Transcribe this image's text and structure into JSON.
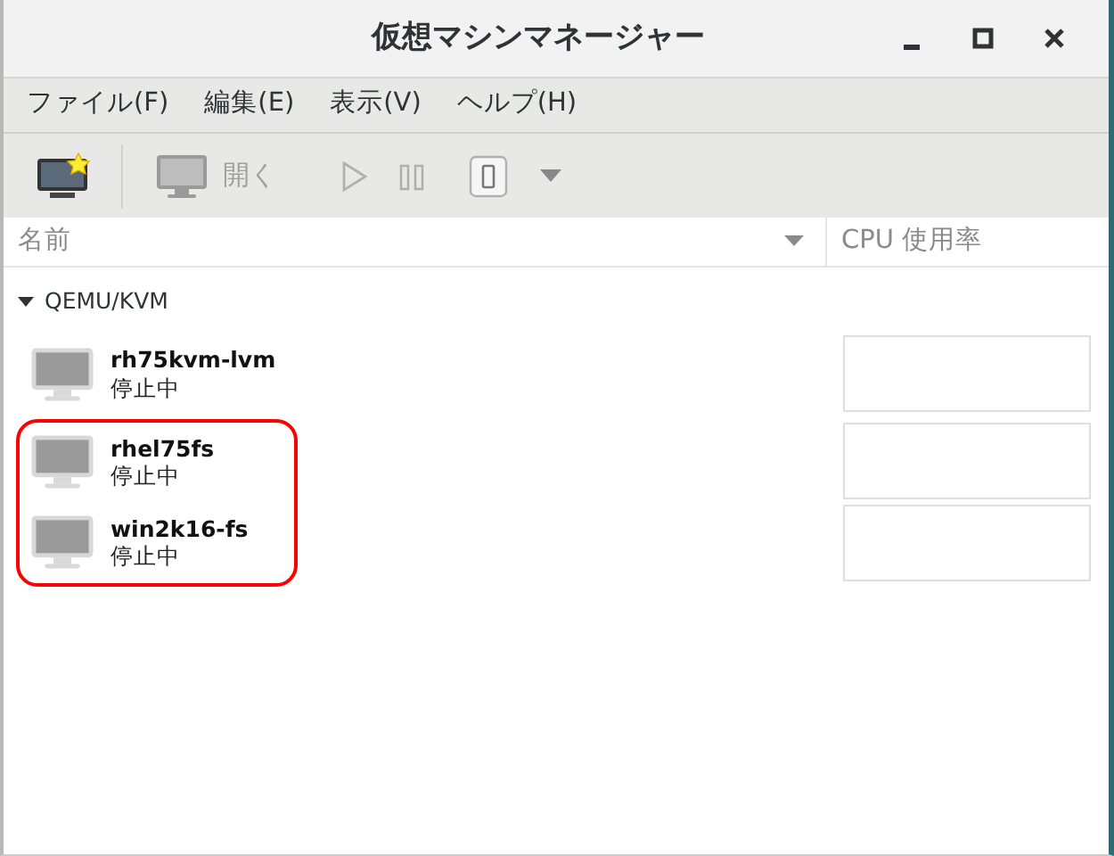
{
  "window": {
    "title": "仮想マシンマネージャー"
  },
  "menu": [
    "ファイル(F)",
    "編集(E)",
    "表示(V)",
    "ヘルプ(H)"
  ],
  "toolbar": [
    {
      "kind": "new",
      "disabled": false
    },
    {
      "kind": "separator"
    },
    {
      "kind": "open",
      "label": "開く",
      "disabled": true
    },
    {
      "kind": "run",
      "disabled": true
    },
    {
      "kind": "pause",
      "disabled": true
    },
    {
      "kind": "shutdown",
      "disabled": true
    },
    {
      "kind": "menu",
      "disabled": true
    }
  ],
  "columns": [
    "名前",
    "CPU 使用率"
  ],
  "group": {
    "name": "QEMU/KVM",
    "expanded": true
  },
  "vms": [
    {
      "name": "rh75kvm-lvm",
      "status": "停止中",
      "annotated": false
    },
    {
      "name": "rhel75fs",
      "status": "停止中",
      "annotated": true
    },
    {
      "name": "win2k16-fs",
      "status": "停止中",
      "annotated": true
    }
  ]
}
